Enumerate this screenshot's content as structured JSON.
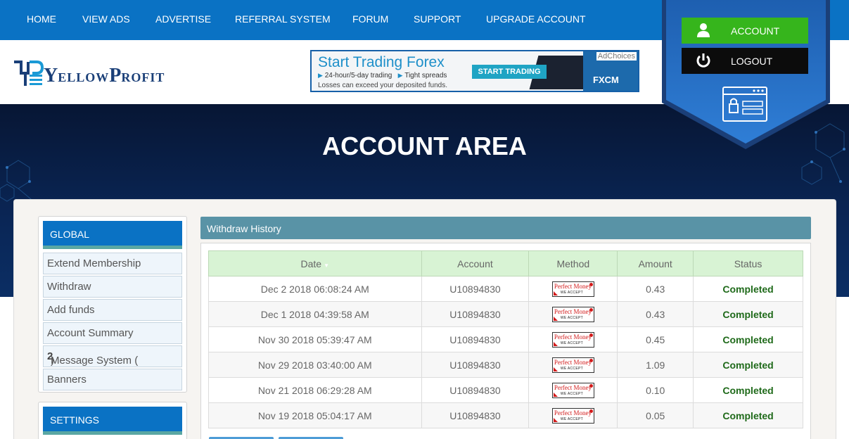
{
  "nav": {
    "items": [
      {
        "label": "HOME"
      },
      {
        "label": "VIEW ADS"
      },
      {
        "label": "ADVERTISE"
      },
      {
        "label": "REFERRAL SYSTEM"
      },
      {
        "label": "FORUM"
      },
      {
        "label": "SUPPORT"
      },
      {
        "label": "UPGRADE ACCOUNT"
      }
    ]
  },
  "logo": {
    "first": "Y",
    "rest1": "ELLOW",
    "second": "P",
    "rest2": "ROFIT"
  },
  "ad": {
    "title": "Start Trading Forex",
    "bullet1": "24-hour/5-day trading",
    "bullet2": "Tight spreads",
    "warning": "Losses can exceed your deposited funds.",
    "button": "START TRADING",
    "choices": "AdChoices",
    "brand": "FXCM"
  },
  "account": {
    "account_label": "ACCOUNT",
    "logout_label": "LOGOUT"
  },
  "hero": {
    "title": "ACCOUNT AREA"
  },
  "sidebar": {
    "global_title": "GLOBAL",
    "items": [
      {
        "label": "Extend Membership"
      },
      {
        "label": "Withdraw"
      },
      {
        "label": "Add funds"
      },
      {
        "label": "Account Summary"
      },
      {
        "label": "Message System (",
        "count": "2",
        "suffix": ")"
      },
      {
        "label": "Banners"
      }
    ],
    "settings_title": "SETTINGS"
  },
  "withdraw": {
    "title": "Withdraw History",
    "columns": [
      "Date",
      "Account",
      "Method",
      "Amount",
      "Status"
    ],
    "sort_indicator": "▼",
    "method_logo": {
      "top": "Perfect Money",
      "bottom": "WE ACCEPT"
    },
    "rows": [
      {
        "date": "Dec 2 2018 06:08:24 AM",
        "account": "U10894830",
        "amount": "0.43",
        "status": "Completed"
      },
      {
        "date": "Dec 1 2018 04:39:58 AM",
        "account": "U10894830",
        "amount": "0.43",
        "status": "Completed"
      },
      {
        "date": "Nov 30 2018 05:39:47 AM",
        "account": "U10894830",
        "amount": "0.45",
        "status": "Completed"
      },
      {
        "date": "Nov 29 2018 03:40:00 AM",
        "account": "U10894830",
        "amount": "1.09",
        "status": "Completed"
      },
      {
        "date": "Nov 21 2018 06:29:28 AM",
        "account": "U10894830",
        "amount": "0.10",
        "status": "Completed"
      },
      {
        "date": "Nov 19 2018 05:04:17 AM",
        "account": "U10894830",
        "amount": "0.05",
        "status": "Completed"
      }
    ]
  },
  "colors": {
    "nav_blue": "#0a72c4",
    "account_green": "#36b51c",
    "table_header": "#d8f3d4",
    "status_green": "#1f6a1a",
    "bar_teal": "#5993a6"
  }
}
